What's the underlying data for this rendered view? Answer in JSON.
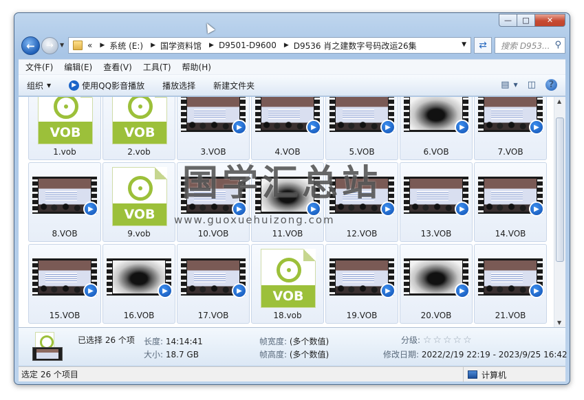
{
  "window": {
    "min": "0",
    "max": "1",
    "close": "r"
  },
  "address": {
    "overflow": "«",
    "crumbs": [
      "系统 (E:)",
      "国学资料馆",
      "D9501-D9600",
      "D9536 肖之建数字号码改运26集"
    ],
    "search_placeholder": "搜索 D953..."
  },
  "menu": [
    "文件(F)",
    "编辑(E)",
    "查看(V)",
    "工具(T)",
    "帮助(H)"
  ],
  "toolbar": {
    "organize": "组织",
    "play_qq": "使用QQ影音播放",
    "play_selected": "播放选择",
    "new_folder": "新建文件夹",
    "help": "?"
  },
  "files": [
    {
      "name": "1.vob",
      "kind": "icon"
    },
    {
      "name": "2.vob",
      "kind": "icon"
    },
    {
      "name": "3.VOB",
      "kind": "lecture"
    },
    {
      "name": "4.VOB",
      "kind": "lecture"
    },
    {
      "name": "5.VOB",
      "kind": "lecture"
    },
    {
      "name": "6.VOB",
      "kind": "ink"
    },
    {
      "name": "7.VOB",
      "kind": "lecture"
    },
    {
      "name": "8.VOB",
      "kind": "lecture"
    },
    {
      "name": "9.vob",
      "kind": "icon"
    },
    {
      "name": "10.VOB",
      "kind": "lecture"
    },
    {
      "name": "11.VOB",
      "kind": "ink"
    },
    {
      "name": "12.VOB",
      "kind": "lecture"
    },
    {
      "name": "13.VOB",
      "kind": "lecture"
    },
    {
      "name": "14.VOB",
      "kind": "lecture"
    },
    {
      "name": "15.VOB",
      "kind": "lecture"
    },
    {
      "name": "16.VOB",
      "kind": "ink"
    },
    {
      "name": "17.VOB",
      "kind": "lecture"
    },
    {
      "name": "18.vob",
      "kind": "icon"
    },
    {
      "name": "19.VOB",
      "kind": "lecture"
    },
    {
      "name": "20.VOB",
      "kind": "ink"
    },
    {
      "name": "21.VOB",
      "kind": "lecture"
    }
  ],
  "icon_text": "VOB",
  "watermark": {
    "title": "国学汇总站",
    "url": "www.guoxuehuizong.com"
  },
  "details": {
    "selected": "已选择 26 个项",
    "length_label": "长度:",
    "length": "14:14:41",
    "size_label": "大小:",
    "size": "18.7 GB",
    "fw_label": "帧宽度:",
    "fw": "(多个数值)",
    "fh_label": "帧高度:",
    "fh": "(多个数值)",
    "rating_label": "分级:",
    "rating_stars": "☆☆☆☆☆",
    "modified_label": "修改日期:",
    "modified": "2022/2/19 22:19 - 2023/9/25 16:42"
  },
  "status": {
    "left": "选定 26 个项目",
    "right": "计算机"
  },
  "colors": {
    "vob_green": "#9cc03a",
    "badge_blue": "#0f4fb0",
    "window_frame": "#a8c5e6"
  }
}
